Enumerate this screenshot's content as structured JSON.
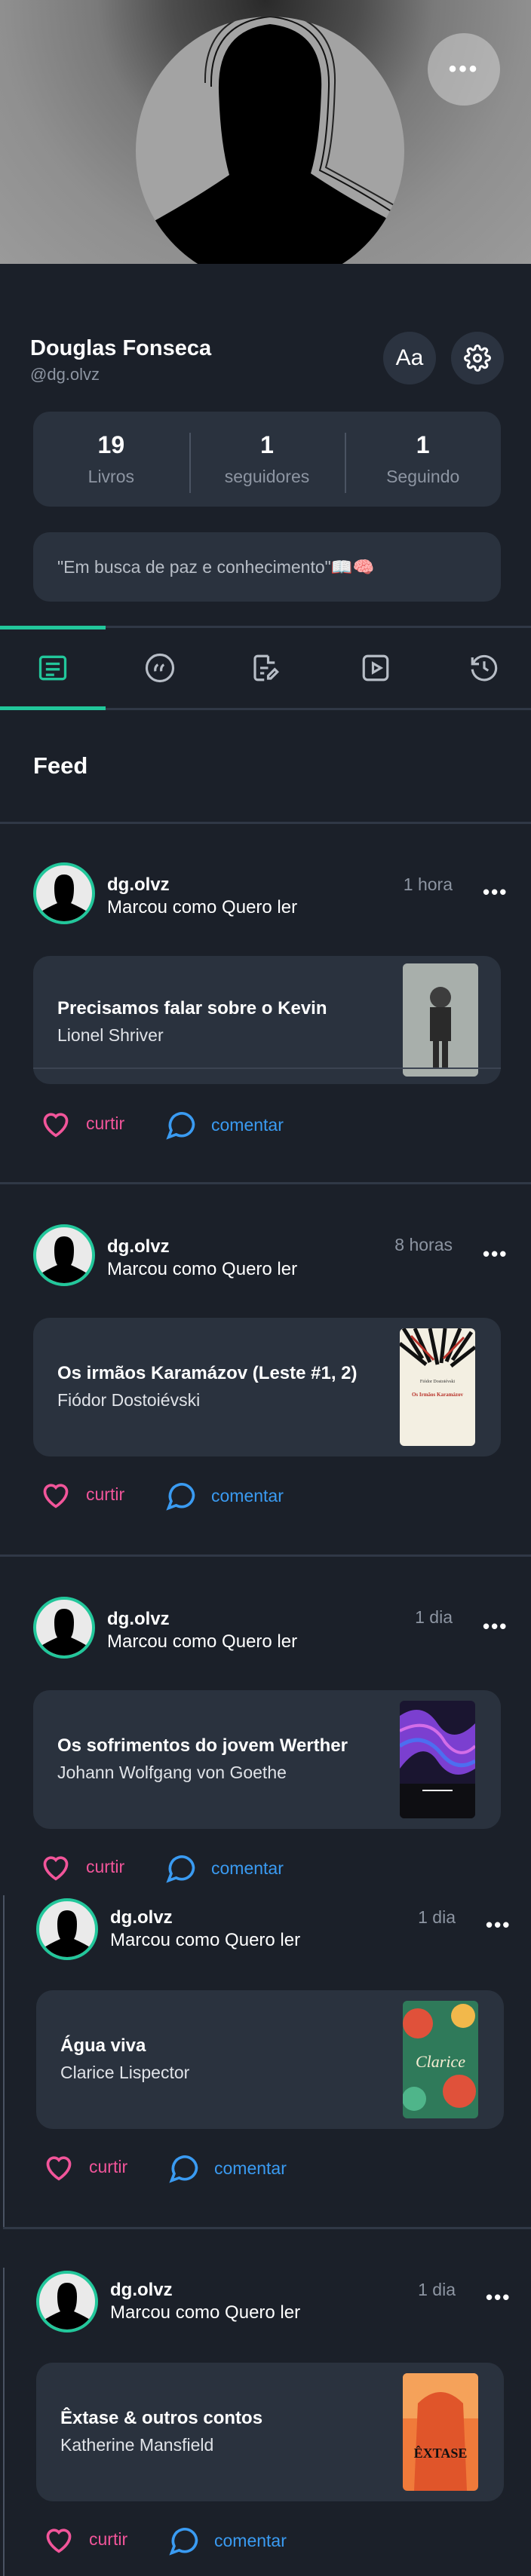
{
  "header": {
    "menu_icon": "more-horizontal-icon",
    "more_label": "•••"
  },
  "profile": {
    "name": "Douglas Fonseca",
    "handle": "@dg.olvz",
    "font_button_label": "Aa",
    "bio": "\"Em busca de paz e conhecimento\"📖🧠"
  },
  "stats": [
    {
      "value": "19",
      "label": "Livros"
    },
    {
      "value": "1",
      "label": "seguidores"
    },
    {
      "value": "1",
      "label": "Seguindo"
    }
  ],
  "tabs": [
    {
      "icon": "feed-icon",
      "active": true
    },
    {
      "icon": "quote-icon"
    },
    {
      "icon": "review-icon"
    },
    {
      "icon": "video-icon"
    },
    {
      "icon": "history-icon"
    }
  ],
  "feed": {
    "title": "Feed"
  },
  "posts": [
    {
      "user": "dg.olvz",
      "action": "Marcou como Quero ler",
      "time": "1 hora",
      "book_title": "Precisamos falar sobre o Kevin",
      "book_author": "Lionel Shriver",
      "like_label": "curtir",
      "comment_label": "comentar"
    },
    {
      "user": "dg.olvz",
      "action": "Marcou como Quero ler",
      "time": "8 horas",
      "book_title": "Os irmãos Karamázov (Leste #1, 2)",
      "book_author": "Fiódor Dostoiévski",
      "like_label": "curtir",
      "comment_label": "comentar",
      "cover_text_top": "Fiódor Dostoiévski",
      "cover_text_title": "Os Irmãos Karamázov"
    },
    {
      "user": "dg.olvz",
      "action": "Marcou como Quero ler",
      "time": "1 dia",
      "book_title": "Os sofrimentos do jovem Werther",
      "book_author": "Johann Wolfgang von Goethe",
      "like_label": "curtir",
      "comment_label": "comentar"
    },
    {
      "user": "dg.olvz",
      "action": "Marcou como Quero ler",
      "time": "1 dia",
      "book_title": "Água viva",
      "book_author": "Clarice Lispector",
      "like_label": "curtir",
      "comment_label": "comentar",
      "cover_text": "Clarice"
    },
    {
      "user": "dg.olvz",
      "action": "Marcou como Quero ler",
      "time": "1 dia",
      "book_title": "Êxtase & outros contos",
      "book_author": "Katherine Mansfield",
      "like_label": "curtir",
      "comment_label": "comentar",
      "cover_text": "ÊXTASE"
    }
  ],
  "colors": {
    "accent": "#22c79b",
    "like": "#f2559a",
    "comment": "#3a9bf2",
    "background": "#1b2029",
    "card": "#2a323e"
  }
}
